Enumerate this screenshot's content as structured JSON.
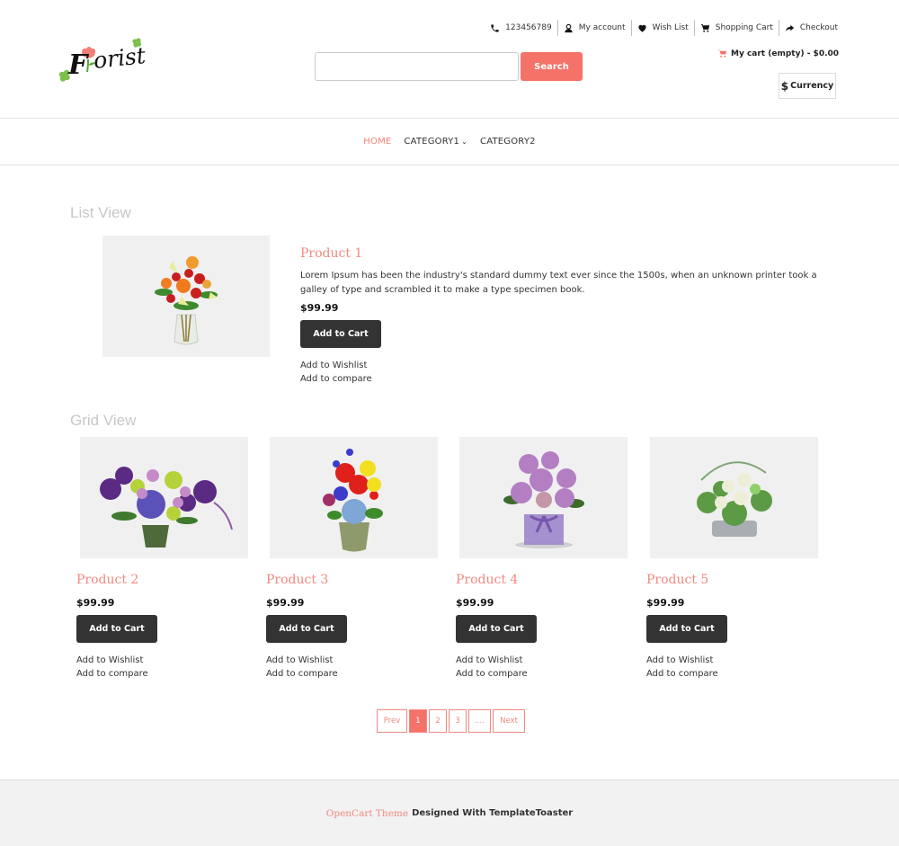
{
  "header": {
    "logo_text": "Florist",
    "topbar": [
      {
        "icon": "phone-icon",
        "label": "123456789"
      },
      {
        "icon": "user-icon",
        "label": "My account"
      },
      {
        "icon": "heart-icon",
        "label": "Wish List"
      },
      {
        "icon": "cart-icon",
        "label": "Shopping Cart"
      },
      {
        "icon": "share-arrow-icon",
        "label": "Checkout"
      }
    ],
    "search": {
      "placeholder": "",
      "value": "",
      "button_label": "Search"
    },
    "mini_cart": "My cart (empty) - $0.00",
    "currency": {
      "symbol": "$",
      "label": "Currency"
    }
  },
  "nav": {
    "items": [
      {
        "label": "HOME",
        "active": true
      },
      {
        "label": "CATEGORY1",
        "dropdown": true
      },
      {
        "label": "CATEGORY2"
      }
    ],
    "chevron": "⌄"
  },
  "list_view": {
    "title": "List View",
    "product": {
      "name": "Product 1",
      "description": "Lorem Ipsum has been the industry's standard dummy text ever since the 1500s, when an unknown printer took a galley of type and scrambled it to make a type specimen book.",
      "price": "$99.99",
      "add_to_cart": "Add to Cart",
      "add_to_wishlist": "Add to Wishlist",
      "add_to_compare": "Add to compare"
    }
  },
  "grid_view": {
    "title": "Grid View",
    "products": [
      {
        "name": "Product 2",
        "price": "$99.99",
        "add_to_cart": "Add to Cart",
        "add_to_wishlist": "Add to Wishlist",
        "add_to_compare": "Add to compare"
      },
      {
        "name": "Product 3",
        "price": "$99.99",
        "add_to_cart": "Add to Cart",
        "add_to_wishlist": "Add to Wishlist",
        "add_to_compare": "Add to compare"
      },
      {
        "name": "Product 4",
        "price": "$99.99",
        "add_to_cart": "Add to Cart",
        "add_to_wishlist": "Add to Wishlist",
        "add_to_compare": "Add to compare"
      },
      {
        "name": "Product 5",
        "price": "$99.99",
        "add_to_cart": "Add to Cart",
        "add_to_wishlist": "Add to Wishlist",
        "add_to_compare": "Add to compare"
      }
    ]
  },
  "pagination": {
    "prev": "Prev",
    "pages": [
      "1",
      "2",
      "3",
      "...."
    ],
    "current": "1",
    "next": "Next"
  },
  "footer": {
    "link": "OpenCart Theme",
    "text": "Designed With TemplateToaster"
  },
  "colors": {
    "accent": "#f57268",
    "product_name": "#ef8a82",
    "button_dark": "#333333",
    "footer_bg": "#f2f2f2"
  }
}
